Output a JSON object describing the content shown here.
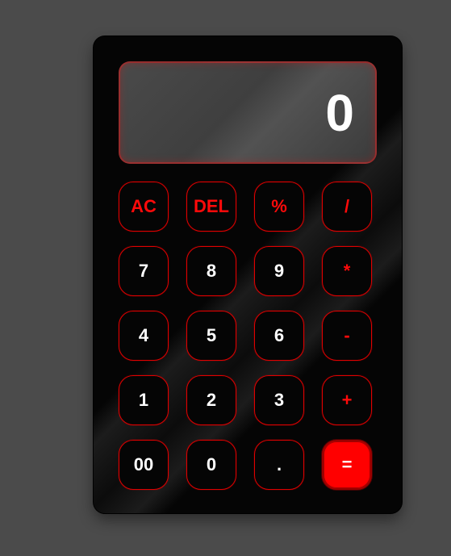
{
  "display": {
    "value": "0"
  },
  "keys": [
    {
      "label": "AC",
      "name": "ac-button",
      "type": "op"
    },
    {
      "label": "DEL",
      "name": "del-button",
      "type": "op"
    },
    {
      "label": "%",
      "name": "percent-button",
      "type": "op"
    },
    {
      "label": "/",
      "name": "divide-button",
      "type": "op"
    },
    {
      "label": "7",
      "name": "digit-7-button",
      "type": "num"
    },
    {
      "label": "8",
      "name": "digit-8-button",
      "type": "num"
    },
    {
      "label": "9",
      "name": "digit-9-button",
      "type": "num"
    },
    {
      "label": "*",
      "name": "multiply-button",
      "type": "op"
    },
    {
      "label": "4",
      "name": "digit-4-button",
      "type": "num"
    },
    {
      "label": "5",
      "name": "digit-5-button",
      "type": "num"
    },
    {
      "label": "6",
      "name": "digit-6-button",
      "type": "num"
    },
    {
      "label": "-",
      "name": "minus-button",
      "type": "op"
    },
    {
      "label": "1",
      "name": "digit-1-button",
      "type": "num"
    },
    {
      "label": "2",
      "name": "digit-2-button",
      "type": "num"
    },
    {
      "label": "3",
      "name": "digit-3-button",
      "type": "num"
    },
    {
      "label": "+",
      "name": "plus-button",
      "type": "op"
    },
    {
      "label": "00",
      "name": "double-zero-button",
      "type": "num"
    },
    {
      "label": "0",
      "name": "digit-0-button",
      "type": "num"
    },
    {
      "label": ".",
      "name": "decimal-button",
      "type": "num"
    },
    {
      "label": "=",
      "name": "equals-button",
      "type": "equals"
    }
  ],
  "colors": {
    "background": "#4b4b4b",
    "body": "#050505",
    "accent": "#ff0000",
    "text": "#ffffff"
  }
}
